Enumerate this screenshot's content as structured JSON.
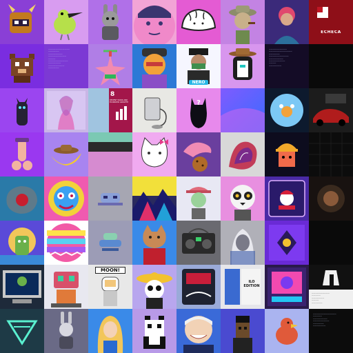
{
  "gallery": {
    "columns": 8,
    "rows": 8,
    "texts": {
      "slice_mark": "ECHECA",
      "nero_badge": "NERO",
      "un_number": "8",
      "un_goal": "DECENT WORK AND ECONOMIC GROWTH",
      "moon_banner": "MOON!",
      "ilo_edition": "ILO EDITION"
    }
  }
}
